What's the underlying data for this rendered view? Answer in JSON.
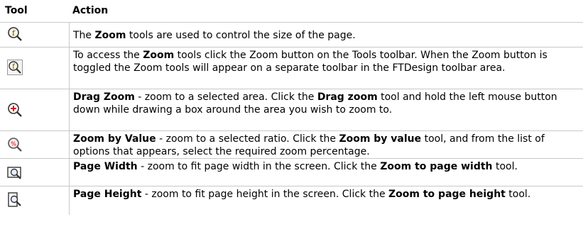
{
  "header": {
    "tool": "Tool",
    "action": "Action"
  },
  "rows": [
    {
      "icon": "zoom-magnifier-icon",
      "parts": [
        "The ",
        "Zoom",
        " tools are used to control the size of the page."
      ]
    },
    {
      "icon": "zoom-toggle-button-icon",
      "parts": [
        "To access the ",
        "Zoom",
        " tools click the Zoom button on the Tools toolbar. When the Zoom button is toggled the Zoom tools will appear on a separate toolbar in the FTDesign toolbar area."
      ]
    },
    {
      "icon": "drag-zoom-icon",
      "parts": [
        "Drag Zoom",
        " - zoom to a selected area. Click the ",
        "Drag zoom",
        " tool and hold the left mouse button down while drawing a box around the area you wish to zoom to."
      ]
    },
    {
      "icon": "zoom-by-value-icon",
      "parts": [
        "Zoom by Value",
        " - zoom to a selected ratio. Click the ",
        "Zoom by value",
        " tool, and from the list of options that appears, select the required zoom percentage."
      ]
    },
    {
      "icon": "page-width-icon",
      "parts": [
        "Page Width",
        " - zoom to fit page width in the screen. Click the ",
        "Zoom to page width",
        " tool."
      ]
    },
    {
      "icon": "page-height-icon",
      "parts": [
        "Page Height",
        " - zoom to fit page height in the screen. Click the ",
        "Zoom to page height",
        " tool."
      ]
    }
  ]
}
